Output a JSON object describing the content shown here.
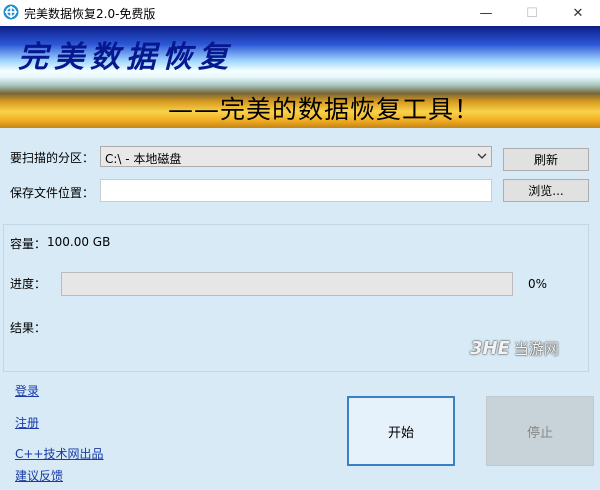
{
  "window": {
    "title": "完美数据恢复2.0-免费版",
    "controls": {
      "minimize": "—",
      "maximize": "☐",
      "close": "✕"
    }
  },
  "banner": {
    "title": "完美数据恢复",
    "subtitle": "——完美的数据恢复工具！"
  },
  "form": {
    "partition_label": "要扫描的分区：",
    "partition_value": "C:\\  -  本地磁盘",
    "save_label": "保存文件位置：",
    "save_value": "",
    "refresh_label": "刷新",
    "browse_label": "浏览..."
  },
  "status": {
    "capacity_label": "容量：",
    "capacity_value": "100.00 GB",
    "progress_label": "进度：",
    "progress_percent_text": "0%",
    "progress_fraction": 0,
    "result_label": "结果："
  },
  "links": {
    "login": "登录",
    "register": "注册",
    "publisher": "C++技术网出品",
    "feedback": "建议反馈"
  },
  "actions": {
    "start_label": "开始",
    "stop_label": "停止"
  },
  "watermark": {
    "logo": "3HE",
    "text": "当游网"
  },
  "colors": {
    "banner_title": "#07178d",
    "link": "#1a3aa8",
    "form_background": "#d7eaf5",
    "start_border": "#3b7fc4"
  }
}
